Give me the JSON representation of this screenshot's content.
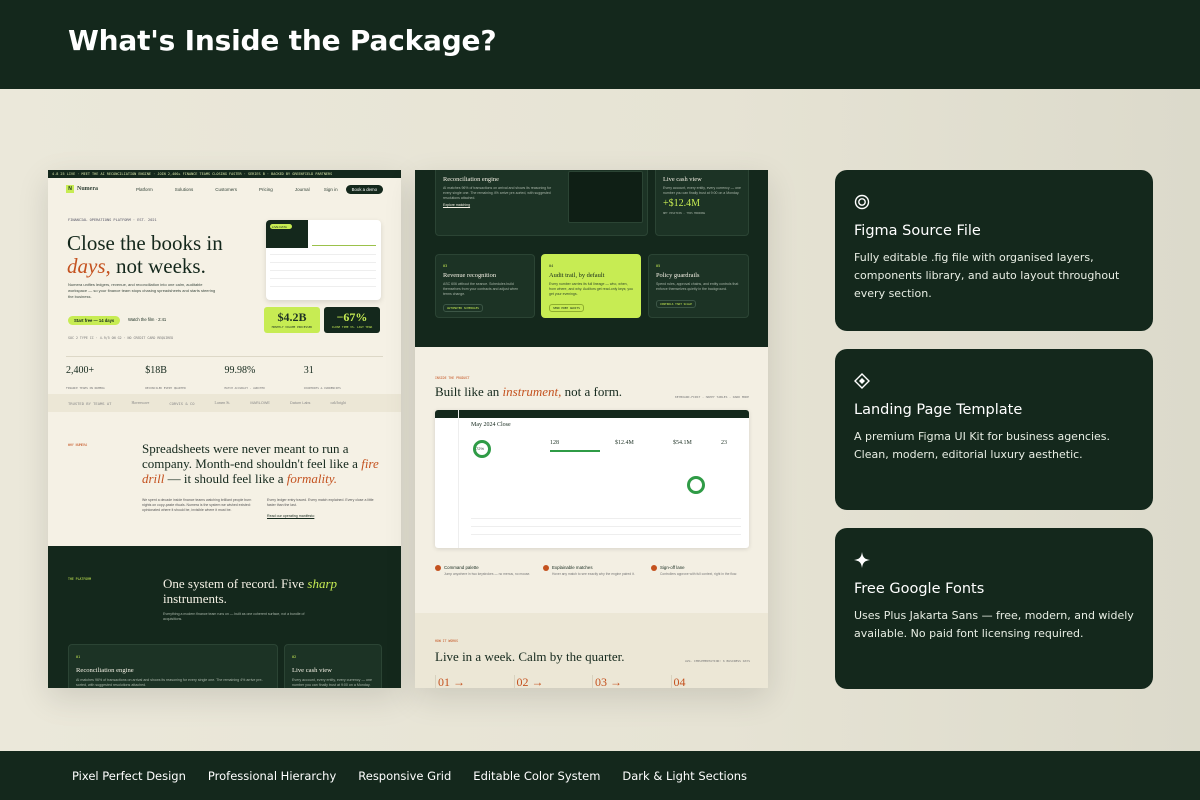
{
  "header": {
    "title": "What's Inside the Package?"
  },
  "footer": {
    "items": [
      "Pixel Perfect Design",
      "Professional Hierarchy",
      "Responsive Grid",
      "Editable Color System",
      "Dark & Light Sections"
    ]
  },
  "cards": [
    {
      "icon": "target-icon",
      "title": "Figma Source File",
      "desc": "Fully editable .fig file with organised layers, components library, and auto layout throughout every section."
    },
    {
      "icon": "diamond-icon",
      "title": "Landing Page Template",
      "desc": "A premium Figma UI Kit for business agencies. Clean, modern, editorial luxury aesthetic."
    },
    {
      "icon": "sparkle-icon",
      "title": "Free Google Fonts",
      "desc": "Uses Plus Jakarta Sans — free, modern, and widely available. No paid font licensing required."
    }
  ],
  "mock1": {
    "ticker": "4.8 25 LIVE · MEET THE AI RECONCILIATION ENGINE · JOIN 2,400+ FINANCE TEAMS CLOSING FASTER · SERIES B · BACKED BY GREENFIELD PARTNERS",
    "brand": "Numera",
    "nav": [
      "Platform",
      "Solutions",
      "Customers",
      "Pricing",
      "Journal"
    ],
    "signin": "Sign in",
    "cta": "Book a demo",
    "hero_label": "FINANCIAL OPERATIONS PLATFORM · EST. 2021",
    "hero_title_1": "Close the books in",
    "hero_title_em": "days,",
    "hero_title_2": "not weeks.",
    "hero_sub": "Numera unifies ledgers, revenue, and reconciliation into one calm, auditable workspace — so your finance team stops chasing spreadsheets and starts steering the business.",
    "btn_primary": "Start free — 14 days",
    "btn_secondary": "Watch the film · 2:41",
    "hero_meta": "SOC 2 TYPE II · 4.9/5 ON G2 · NO CREDIT CARD REQUIRED",
    "dash_badge": "LIVE DATA",
    "kpi1_value": "$4.2B",
    "kpi1_label": "MONTHLY VOLUME PROCESSED",
    "kpi2_value": "−67%",
    "kpi2_label": "CLOSE TIME VS. LAST YEAR",
    "stats": [
      {
        "value": "2,400+",
        "label": "FINANCE TEAMS ON NUMERA"
      },
      {
        "value": "$18B",
        "label": "RECONCILED EVERY QUARTER"
      },
      {
        "value": "99.98%",
        "label": "MATCH ACCURACY · AUDITED"
      },
      {
        "value": "31",
        "label": "COUNTRIES & CURRENCIES"
      }
    ],
    "trusted_label": "TRUSTED BY TEAMS AT",
    "trusted": [
      "Havenwave",
      "CORVIS & CO",
      "Lumen St.",
      "MARLOWE",
      "Datum Labs",
      "oak/bright"
    ],
    "why_label": "WHY NUMERA",
    "why_title_1": "Spreadsheets were never meant to run a company. Month-end shouldn't feel like a",
    "why_em1": "fire drill",
    "why_title_2": "— it should feel like a",
    "why_em2": "formality.",
    "why_p1": "We spent a decade inside finance teams watching brilliant people burn nights on copy-paste rituals. Numera is the system we wished existed: opinionated where it should be, invisible where it must be.",
    "why_p2": "Every ledger entry traced. Every match explained. Every close a little faster than the last.",
    "why_link": "Read our operating manifesto",
    "plat_label": "THE PLATFORM",
    "plat_title_1": "One system of record. Five",
    "plat_em": "sharp",
    "plat_title_2": "instruments.",
    "plat_sub": "Everything a modern finance team runs on — built as one coherent surface, not a bundle of acquisitions.",
    "card1": {
      "num": "01",
      "title": "Reconciliation engine",
      "desc": "AI matches 96% of transactions on arrival and shows its reasoning for every single one. The remaining 4% arrive pre-sorted, with suggested resolutions attached."
    },
    "card2": {
      "num": "02",
      "title": "Live cash view",
      "desc": "Every account, every entity, every currency — one number you can finally trust at 9:00 on a Monday."
    }
  },
  "mock2": {
    "top1": {
      "title": "Reconciliation engine",
      "desc": "AI matches 96% of transactions on arrival and shows its reasoning for every single one. The remaining 4% arrive pre-sorted, with suggested resolutions attached.",
      "link": "Explore matching"
    },
    "top2": {
      "title": "Live cash view",
      "desc": "Every account, every entity, every currency — one number you can finally trust at 9:00 on a Monday.",
      "value": "+$12.4M",
      "note": "NET POSITION · THIS MORNING"
    },
    "row": [
      {
        "num": "03",
        "title": "Revenue recognition",
        "desc": "ASC 606 without the seance. Schedules build themselves from your contracts and adjust when terms change.",
        "tag": "AUTOMATED SCHEDULES"
      },
      {
        "num": "04",
        "title": "Audit trail, by default",
        "desc": "Every number carries its full lineage — who, when, from where, and why. Auditors get read-only keys; you get your evenings.",
        "tag": "SEND PREP AUDITS"
      },
      {
        "num": "05",
        "title": "Policy guardrails",
        "desc": "Spend rules, approval chains, and entity controls that enforce themselves quietly in the background.",
        "tag": "CONTROLS THAT SCALE"
      }
    ],
    "prod_label": "INSIDE THE PRODUCT",
    "prod_title_1": "Built like an",
    "prod_em": "instrument,",
    "prod_title_2": "not a form.",
    "prod_meta": "KEYBOARD-FIRST · HAPPY TABLES · DARK MODE",
    "app_title": "May 2024 Close",
    "app_stats": [
      "72%",
      "128",
      "$12.4M",
      "$54.1M",
      "23"
    ],
    "features": [
      {
        "title": "Command palette",
        "desc": "Jump anywhere in two keystrokes — no menus, no mouse."
      },
      {
        "title": "Explainable matches",
        "desc": "Hover any match to see exactly why the engine paired it."
      },
      {
        "title": "Sign-off lane",
        "desc": "Controllers approve with full context, right in the flow."
      }
    ],
    "how_label": "HOW IT WORKS",
    "how_title": "Live in a week. Calm by the quarter.",
    "how_meta": "AVG. IMPLEMENTATION: 6 BUSINESS DAYS",
    "steps": [
      "01 →",
      "02 →",
      "03 →",
      "04"
    ]
  }
}
